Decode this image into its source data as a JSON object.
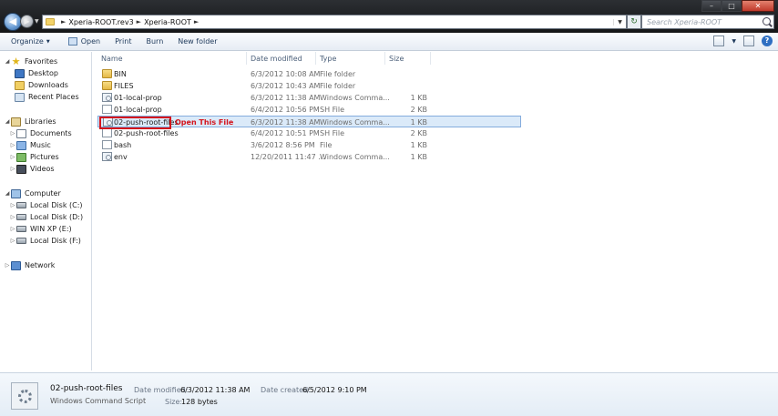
{
  "address": {
    "crumbs": [
      "Xperia-ROOT.rev3",
      "Xperia-ROOT"
    ],
    "search_placeholder": "Search Xperia-ROOT"
  },
  "toolbar": {
    "organize": "Organize",
    "open": "Open",
    "print": "Print",
    "burn": "Burn",
    "new_folder": "New folder"
  },
  "nav": {
    "favorites": "Favorites",
    "desktop": "Desktop",
    "downloads": "Downloads",
    "recent_places": "Recent Places",
    "libraries": "Libraries",
    "documents": "Documents",
    "music": "Music",
    "pictures": "Pictures",
    "videos": "Videos",
    "computer": "Computer",
    "drive_c": "Local Disk (C:)",
    "drive_d": "Local Disk (D:)",
    "drive_e": "WIN XP (E:)",
    "drive_f": "Local Disk (F:)",
    "network": "Network"
  },
  "columns": {
    "name": "Name",
    "date": "Date modified",
    "type": "Type",
    "size": "Size"
  },
  "files": [
    {
      "name": "BIN",
      "date": "6/3/2012 10:08 AM",
      "type": "File folder",
      "size": "",
      "icon": "folder"
    },
    {
      "name": "FILES",
      "date": "6/3/2012 10:43 AM",
      "type": "File folder",
      "size": "",
      "icon": "folder"
    },
    {
      "name": "01-local-prop",
      "date": "6/3/2012 11:38 AM",
      "type": "Windows Comma...",
      "size": "1 KB",
      "icon": "script"
    },
    {
      "name": "01-local-prop",
      "date": "6/4/2012 10:56 PM",
      "type": "SH File",
      "size": "2 KB",
      "icon": "file"
    },
    {
      "name": "02-push-root-files",
      "date": "6/3/2012 11:38 AM",
      "type": "Windows Comma...",
      "size": "1 KB",
      "icon": "script"
    },
    {
      "name": "02-push-root-files",
      "date": "6/4/2012 10:51 PM",
      "type": "SH File",
      "size": "2 KB",
      "icon": "file"
    },
    {
      "name": "bash",
      "date": "3/6/2012 8:56 PM",
      "type": "File",
      "size": "1 KB",
      "icon": "file"
    },
    {
      "name": "env",
      "date": "12/20/2011 11:47 ...",
      "type": "Windows Comma...",
      "size": "1 KB",
      "icon": "script"
    }
  ],
  "annotation": "Open This File",
  "details": {
    "name": "02-push-root-files",
    "type": "Windows Command Script",
    "date_modified_label": "Date modified:",
    "date_modified": "6/3/2012 11:38 AM",
    "date_created_label": "Date created:",
    "date_created": "6/5/2012 9:10 PM",
    "size_label": "Size:",
    "size": "128 bytes"
  }
}
